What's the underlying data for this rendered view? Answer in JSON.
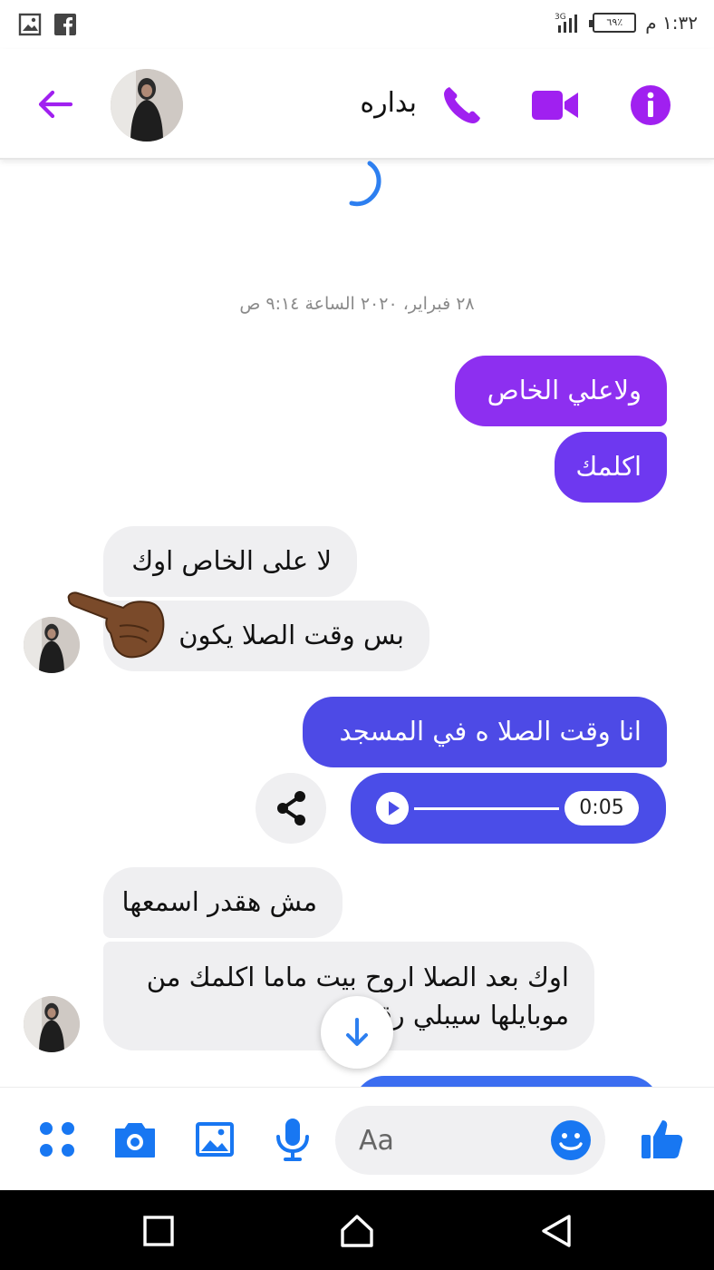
{
  "status_bar": {
    "time": "١:٣٢ م",
    "battery": "٦٩٪",
    "network": "3G"
  },
  "header": {
    "contact_name": "بداره",
    "accent_color": "#a020f0"
  },
  "chat": {
    "date_separator": "٢٨ فبراير، ٢٠٢٠ الساعة ٩:١٤ ص",
    "messages": [
      {
        "id": "m1",
        "direction": "outgoing",
        "text": "ولاعلي الخاص"
      },
      {
        "id": "m2",
        "direction": "outgoing",
        "text": "اكلمك"
      },
      {
        "id": "m3",
        "direction": "incoming",
        "text": "لا على الخاص اوك"
      },
      {
        "id": "m4",
        "direction": "incoming",
        "text": "بس وقت الصلا يكون"
      },
      {
        "id": "m5",
        "direction": "outgoing",
        "text": "انا وقت  الصلا ه في المسجد"
      },
      {
        "id": "m6",
        "direction": "outgoing",
        "type": "audio",
        "duration": "0:05"
      },
      {
        "id": "m7",
        "direction": "incoming",
        "text": "مش هقدر اسمعها"
      },
      {
        "id": "m8",
        "direction": "incoming",
        "lines": [
          "اوك بعد الصلا اروح بيت ماما اكلمك من",
          "موبايلها سيبلي رقم"
        ]
      }
    ]
  },
  "composer": {
    "placeholder": "Aa"
  },
  "icons": {
    "back": "arrow-left-icon",
    "call": "phone-icon",
    "video": "video-camera-icon",
    "info": "info-icon",
    "share": "share-icon",
    "scroll": "arrow-down-icon",
    "apps": "apps-grid-icon",
    "camera": "camera-icon",
    "gallery": "image-icon",
    "mic": "microphone-icon",
    "emoji": "smiley-icon",
    "like": "thumbs-up-icon"
  },
  "colors": {
    "messenger_purple": "#a020f0",
    "messenger_blue": "#1877f2",
    "incoming_bubble": "#efeff1"
  }
}
